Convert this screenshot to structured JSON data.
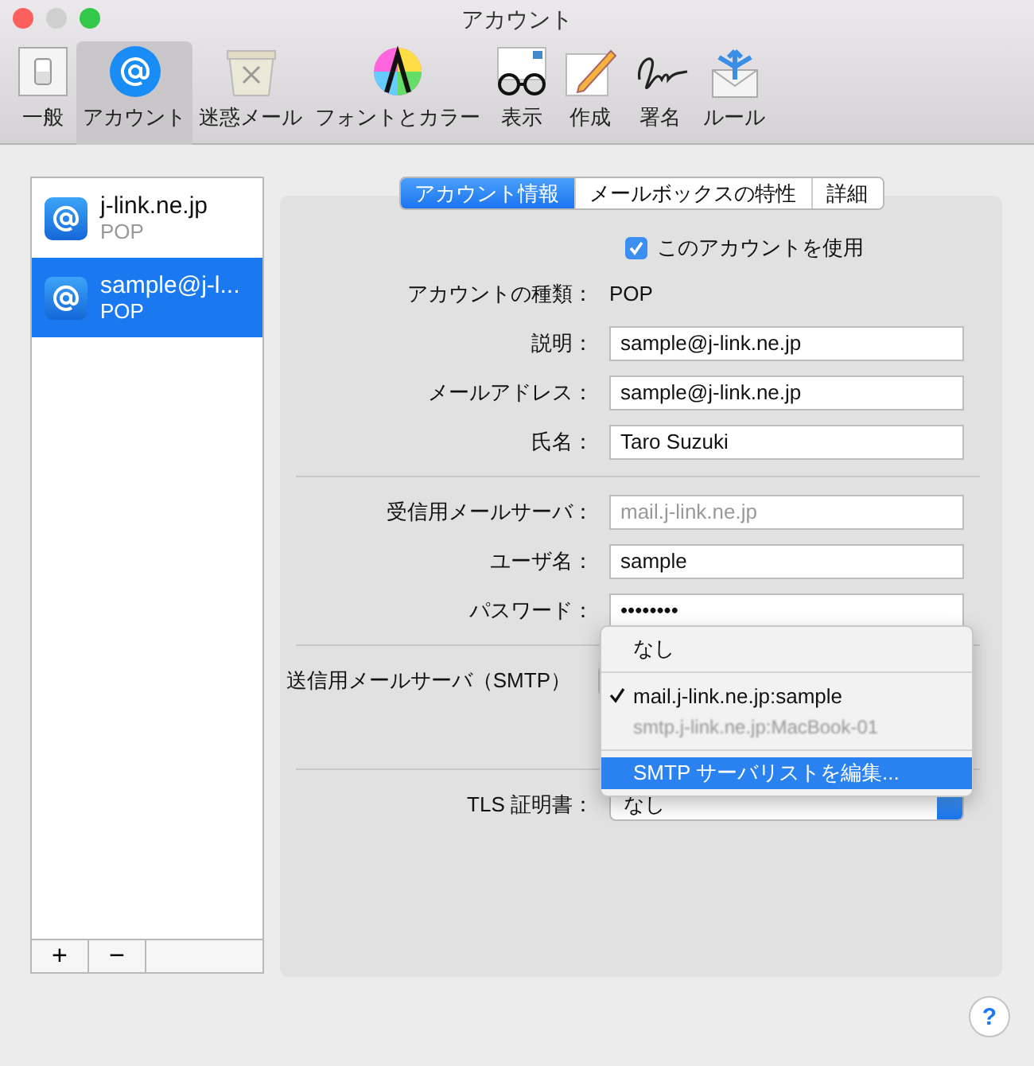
{
  "window": {
    "title": "アカウント"
  },
  "toolbar": [
    {
      "label": "一般",
      "selected": false
    },
    {
      "label": "アカウント",
      "selected": true
    },
    {
      "label": "迷惑メール",
      "selected": false
    },
    {
      "label": "フォントとカラー",
      "selected": false
    },
    {
      "label": "表示",
      "selected": false
    },
    {
      "label": "作成",
      "selected": false
    },
    {
      "label": "署名",
      "selected": false
    },
    {
      "label": "ルール",
      "selected": false
    }
  ],
  "accounts": [
    {
      "name": "j-link.ne.jp",
      "type": "POP",
      "selected": false
    },
    {
      "name": "sample@j-l...",
      "type": "POP",
      "selected": true
    }
  ],
  "list_buttons": [
    "+",
    "−"
  ],
  "tabs": [
    {
      "label": "アカウント情報",
      "selected": true
    },
    {
      "label": "メールボックスの特性",
      "selected": false
    },
    {
      "label": "詳細",
      "selected": false
    }
  ],
  "enable_account": {
    "label": "このアカウントを使用",
    "checked": true
  },
  "account_type": {
    "label": "アカウントの種類：",
    "value": "POP"
  },
  "identity_fields": [
    {
      "label": "説明：",
      "value": "sample@j-link.ne.jp"
    },
    {
      "label": "メールアドレス：",
      "value": "sample@j-link.ne.jp"
    },
    {
      "label": "氏名：",
      "value": "Taro Suzuki"
    }
  ],
  "incoming_fields": [
    {
      "label": "受信用メールサーバ：",
      "placeholder": "mail.j-link.ne.jp"
    },
    {
      "label": "ユーザ名：",
      "value": "sample"
    },
    {
      "label": "パスワード：",
      "value": "••••••••"
    }
  ],
  "smtp": {
    "label": "送信用メールサーバ（SMTP）"
  },
  "smtp_menu": [
    {
      "kind": "item",
      "label": "なし",
      "checked": false,
      "disabled": false,
      "selected": false
    },
    {
      "kind": "separator"
    },
    {
      "kind": "item",
      "label": "mail.j-link.ne.jp:sample",
      "checked": true,
      "disabled": false,
      "selected": false
    },
    {
      "kind": "item",
      "label": "smtp.j-link.ne.jp:MacBook-01",
      "checked": false,
      "disabled": true,
      "selected": false
    },
    {
      "kind": "separator"
    },
    {
      "kind": "item",
      "label": "SMTP サーバリストを編集...",
      "checked": false,
      "disabled": false,
      "selected": true
    }
  ],
  "tls": {
    "label": "TLS 証明書：",
    "value": "なし"
  },
  "help": "?"
}
